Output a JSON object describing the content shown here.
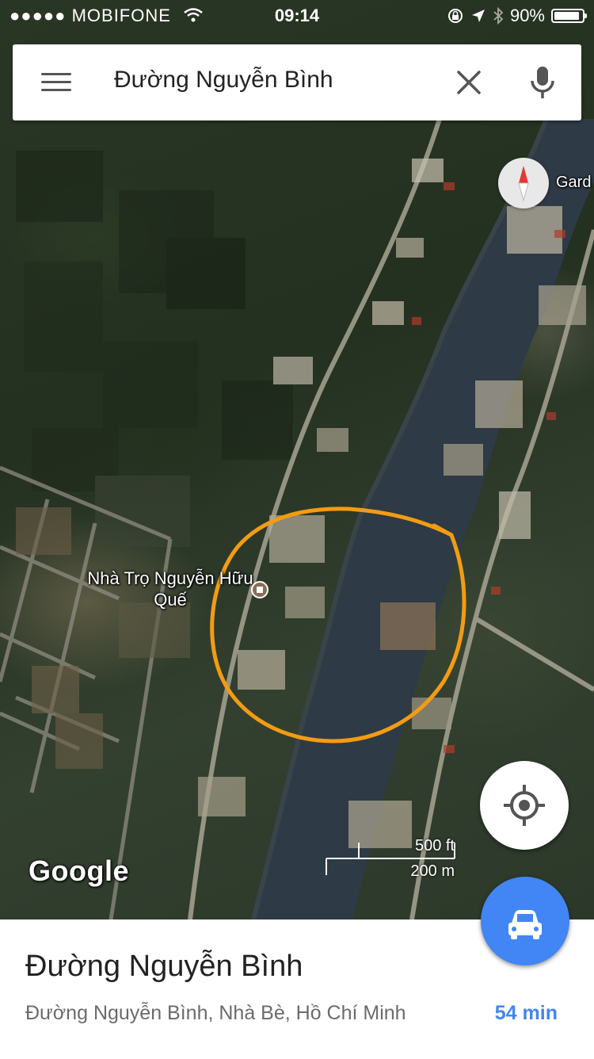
{
  "status_bar": {
    "signal": "●●●●●",
    "carrier": "MOBIFONE",
    "time": "09:14",
    "battery": "90%",
    "battery_level": 0.9
  },
  "search": {
    "query": "Đường Nguyễn Bình",
    "menu_icon": "hamburger-menu-icon",
    "clear_icon": "close-icon",
    "mic_icon": "microphone-icon"
  },
  "map": {
    "compass_icon": "compass-icon",
    "edge_label": "Gard",
    "place_label": "Nhà Trọ Nguyễn Hữu Quế",
    "attribution": "Google",
    "scale": {
      "imperial": "500 ft",
      "metric": "200 m"
    },
    "annotation_color": "#f39c12",
    "locate_icon": "my-location-icon",
    "directions_icon": "car-icon",
    "directions_color": "#4285f4"
  },
  "place_sheet": {
    "title": "Đường Nguyễn Bình",
    "address": "Đường Nguyễn Bình, Nhà Bè, Hồ Chí Minh",
    "eta": "54 min"
  }
}
